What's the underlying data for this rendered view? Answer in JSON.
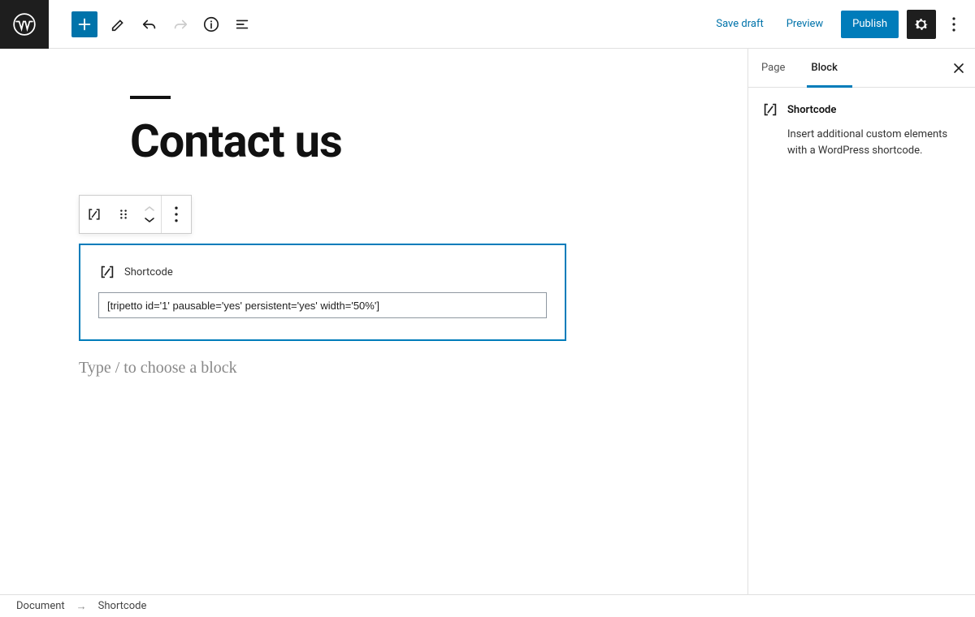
{
  "toolbar": {
    "save_draft": "Save draft",
    "preview": "Preview",
    "publish": "Publish"
  },
  "page": {
    "title": "Contact us"
  },
  "block": {
    "label": "Shortcode",
    "shortcode_value": "[tripetto id='1' pausable='yes' persistent='yes' width='50%']"
  },
  "editor": {
    "new_block_placeholder": "Type / to choose a block"
  },
  "sidebar": {
    "tabs": {
      "page": "Page",
      "block": "Block"
    },
    "block_panel": {
      "title": "Shortcode",
      "description": "Insert additional custom elements with a WordPress shortcode."
    }
  },
  "breadcrumb": {
    "root": "Document",
    "current": "Shortcode"
  }
}
